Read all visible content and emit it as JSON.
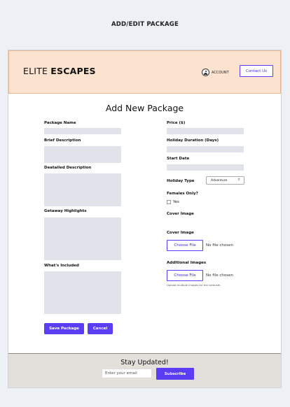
{
  "caption": "ADD/EDIT PACKAGE",
  "header": {
    "brand_regular": "ELITE ",
    "brand_bold": "ESCAPES",
    "account_label": "ACCOUNT",
    "contact_label": "Contact Us"
  },
  "form": {
    "title": "Add New Package",
    "left": {
      "package_name": "Package Name",
      "brief_description": "Brief Description",
      "detailed_description": "Deatailed Description",
      "highlights": "Getaway Highlights",
      "included": "What's Included"
    },
    "right": {
      "price": "Price ($)",
      "duration": "Holiday Duration (Days)",
      "start_date": "Start Date",
      "holiday_type": "Holiday Type",
      "holiday_type_value": "Adventure",
      "females_only": "Females Only?",
      "yes_label": "Yes",
      "cover_image_heading": "Cover Image",
      "cover_image": "Cover Image",
      "additional_images": "Additional Images",
      "choose_file": "Choose File",
      "no_file": "No file chosen",
      "upload_hint": "Upload multiple images for the carousel."
    },
    "save_label": "Save Package",
    "cancel_label": "Cancel"
  },
  "footer": {
    "title": "Stay Updated!",
    "email_placeholder": "Enter your email",
    "subscribe_label": "Subscribe"
  },
  "colors": {
    "accent": "#5b3df5",
    "header_bg": "#fbe3cf",
    "footer_bg": "#e3dfdb"
  }
}
